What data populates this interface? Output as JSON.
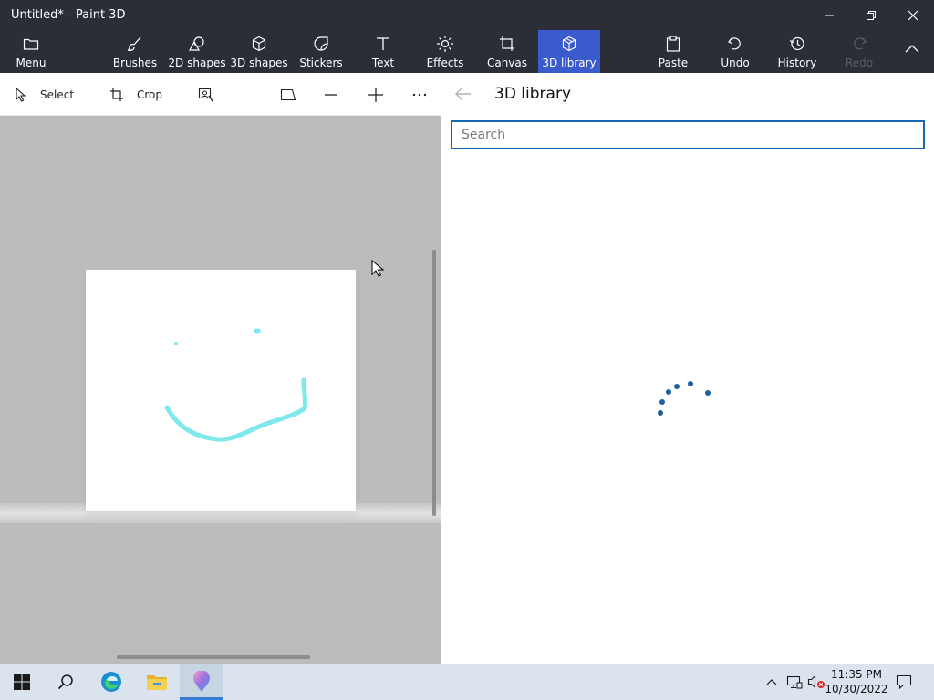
{
  "window": {
    "title": "Untitled* - Paint 3D"
  },
  "ribbon": {
    "menu_label": "Menu",
    "items": [
      {
        "label": "Brushes",
        "icon": "brush-icon"
      },
      {
        "label": "2D shapes",
        "icon": "2d-shapes-icon"
      },
      {
        "label": "3D shapes",
        "icon": "3d-shapes-icon"
      },
      {
        "label": "Stickers",
        "icon": "stickers-icon"
      },
      {
        "label": "Text",
        "icon": "text-icon"
      },
      {
        "label": "Effects",
        "icon": "effects-icon"
      },
      {
        "label": "Canvas",
        "icon": "canvas-icon"
      },
      {
        "label": "3D library",
        "icon": "3d-library-icon",
        "active": true
      }
    ],
    "actions": [
      {
        "label": "Paste",
        "icon": "paste-icon"
      },
      {
        "label": "Undo",
        "icon": "undo-icon"
      },
      {
        "label": "History",
        "icon": "history-icon"
      },
      {
        "label": "Redo",
        "icon": "redo-icon",
        "disabled": true
      }
    ]
  },
  "canvas_toolbar": {
    "select_label": "Select",
    "crop_label": "Crop"
  },
  "panel": {
    "title": "3D library",
    "search_placeholder": "Search"
  },
  "taskbar": {
    "time": "11:35 PM",
    "date": "10/30/2022"
  },
  "colors": {
    "chrome": "#2b2d37",
    "accent": "#3b5bcd",
    "search_border": "#1867b3",
    "doodle": "#7ee8ec",
    "spinner": "#1f5f9e"
  }
}
